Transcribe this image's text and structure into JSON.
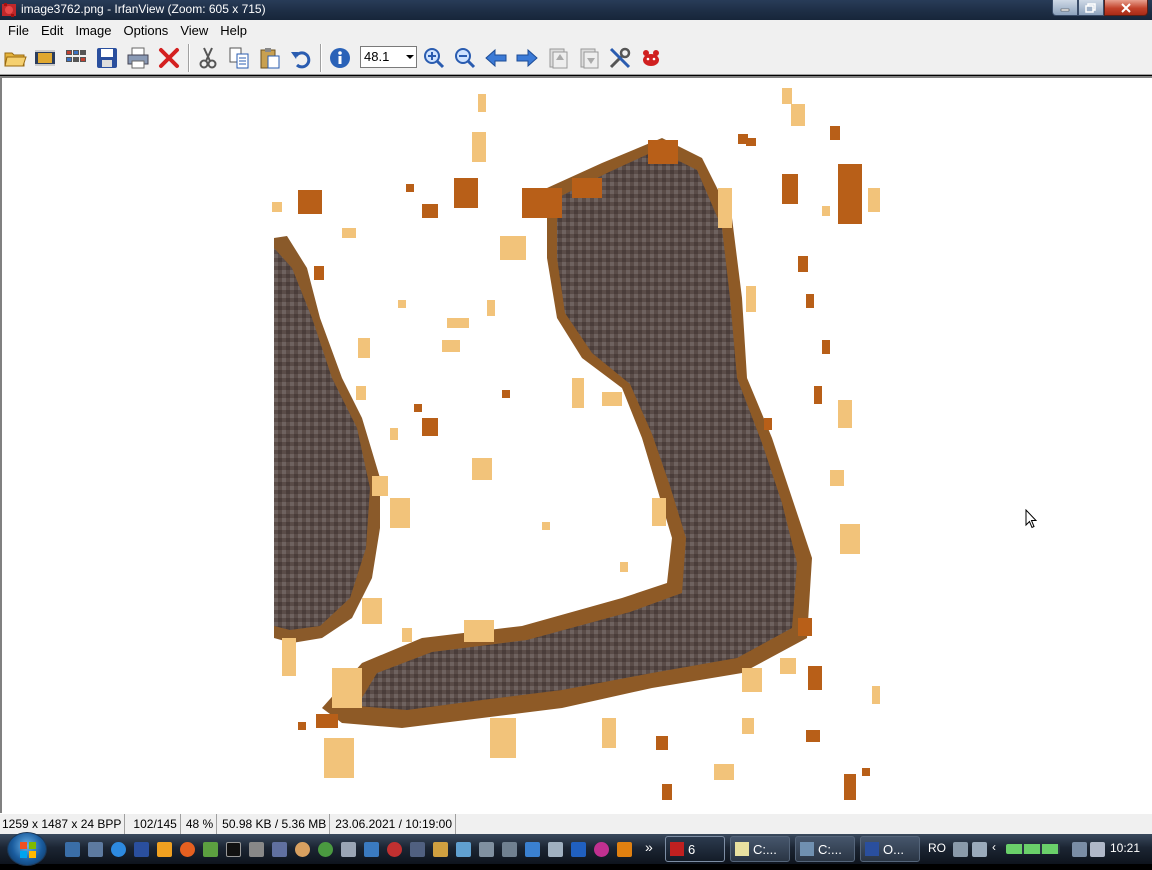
{
  "window": {
    "title": "image3762.png - IrfanView (Zoom: 605 x 715)"
  },
  "menu": [
    "File",
    "Edit",
    "Image",
    "Options",
    "View",
    "Help"
  ],
  "toolbar": {
    "zoom_value": "48.1",
    "icons": [
      "open-folder-icon",
      "slideshow-icon",
      "thumbnails-icon",
      "save-icon",
      "print-icon",
      "delete-icon",
      "cut-icon",
      "copy-icon",
      "paste-icon",
      "undo-icon",
      "info-icon",
      "zoom-in-icon",
      "zoom-out-icon",
      "previous-icon",
      "next-icon",
      "first-page-icon",
      "last-page-icon",
      "settings-icon",
      "irfanview-logo-icon"
    ]
  },
  "status": {
    "dimensions": "1259 x 1487 x 24 BPP",
    "position": "102/145",
    "zoom": "48 %",
    "size": "50.98 KB / 5.36 MB",
    "datetime": "23.06.2021 / 10:19:00"
  },
  "taskbar": {
    "tasks": [
      {
        "label": "6",
        "icon": "irfanview-icon"
      },
      {
        "label": "C:...",
        "icon": "notepad-icon"
      },
      {
        "label": "C:...",
        "icon": "explorer-icon"
      },
      {
        "label": "O...",
        "icon": "save-icon"
      }
    ],
    "language": "RO",
    "clock": "10:21"
  }
}
